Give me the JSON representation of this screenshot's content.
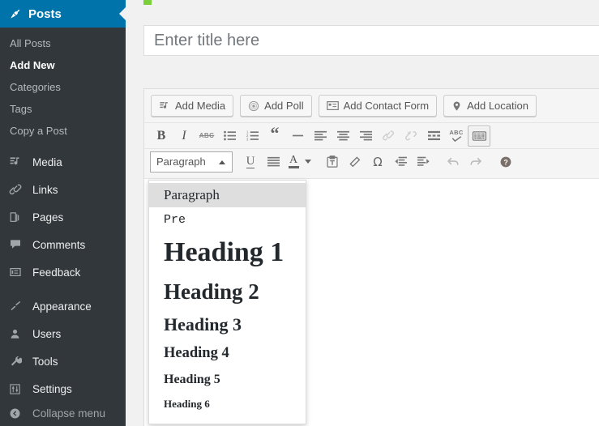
{
  "colors": {
    "admin_blue": "#0073aa",
    "sidebar_bg": "#32373c",
    "page_bg": "#f1f1f1",
    "green_flag": "#7ad03a",
    "text_muted": "#b4b9be"
  },
  "sidebar": {
    "header": {
      "label": "Posts",
      "icon": "pin-icon"
    },
    "submenu": [
      {
        "label": "All Posts",
        "current": false
      },
      {
        "label": "Add New",
        "current": true
      },
      {
        "label": "Categories",
        "current": false
      },
      {
        "label": "Tags",
        "current": false
      },
      {
        "label": "Copy a Post",
        "current": false
      }
    ],
    "items": [
      {
        "label": "Media",
        "icon": "media-icon"
      },
      {
        "label": "Links",
        "icon": "link-icon"
      },
      {
        "label": "Pages",
        "icon": "pages-icon"
      },
      {
        "label": "Comments",
        "icon": "comment-icon"
      },
      {
        "label": "Feedback",
        "icon": "feedback-icon"
      },
      {
        "label": "Appearance",
        "icon": "appearance-icon"
      },
      {
        "label": "Users",
        "icon": "users-icon"
      },
      {
        "label": "Tools",
        "icon": "tools-icon"
      },
      {
        "label": "Settings",
        "icon": "settings-icon"
      }
    ],
    "collapse": {
      "label": "Collapse menu",
      "icon": "collapse-arrow-icon"
    }
  },
  "editor": {
    "title": {
      "placeholder": "Enter title here",
      "value": ""
    },
    "media_buttons": [
      {
        "label": "Add Media",
        "icon": "add-media-icon"
      },
      {
        "label": "Add Poll",
        "icon": "add-poll-icon"
      },
      {
        "label": "Add Contact Form",
        "icon": "contact-form-icon"
      },
      {
        "label": "Add Location",
        "icon": "map-pin-icon"
      }
    ],
    "toolbar_row1": [
      {
        "name": "bold",
        "glyph": "B"
      },
      {
        "name": "italic",
        "glyph": "I"
      },
      {
        "name": "strikethrough",
        "glyph": "ABC"
      },
      {
        "name": "bullet-list",
        "glyph": ""
      },
      {
        "name": "numbered-list",
        "glyph": ""
      },
      {
        "name": "blockquote",
        "glyph": "“"
      },
      {
        "name": "horizontal-rule",
        "glyph": ""
      },
      {
        "name": "align-left",
        "glyph": ""
      },
      {
        "name": "align-center",
        "glyph": ""
      },
      {
        "name": "align-right",
        "glyph": ""
      },
      {
        "name": "insert-link",
        "glyph": ""
      },
      {
        "name": "remove-link",
        "glyph": ""
      },
      {
        "name": "read-more",
        "glyph": ""
      },
      {
        "name": "spellcheck",
        "glyph": "ABC"
      },
      {
        "name": "toggle-toolbar",
        "glyph": ""
      }
    ],
    "toolbar_row2": [
      {
        "name": "underline",
        "glyph": "U"
      },
      {
        "name": "justify",
        "glyph": ""
      },
      {
        "name": "text-color",
        "glyph": "A"
      },
      {
        "name": "paste-as-text",
        "glyph": ""
      },
      {
        "name": "clear-formatting",
        "glyph": ""
      },
      {
        "name": "special-character",
        "glyph": "Ω"
      },
      {
        "name": "outdent",
        "glyph": ""
      },
      {
        "name": "indent",
        "glyph": ""
      },
      {
        "name": "undo",
        "glyph": ""
      },
      {
        "name": "redo",
        "glyph": ""
      },
      {
        "name": "keyboard-shortcuts",
        "glyph": "?"
      }
    ],
    "format_select": {
      "value": "Paragraph",
      "expanded": true,
      "options": [
        {
          "label": "Paragraph",
          "style": "p",
          "selected": true
        },
        {
          "label": "Pre",
          "style": "pre",
          "selected": false
        },
        {
          "label": "Heading 1",
          "style": "h1",
          "selected": false
        },
        {
          "label": "Heading 2",
          "style": "h2",
          "selected": false
        },
        {
          "label": "Heading 3",
          "style": "h3",
          "selected": false
        },
        {
          "label": "Heading 4",
          "style": "h4",
          "selected": false
        },
        {
          "label": "Heading 5",
          "style": "h5",
          "selected": false
        },
        {
          "label": "Heading 6",
          "style": "h6",
          "selected": false
        }
      ]
    },
    "body": {
      "content": ""
    }
  }
}
